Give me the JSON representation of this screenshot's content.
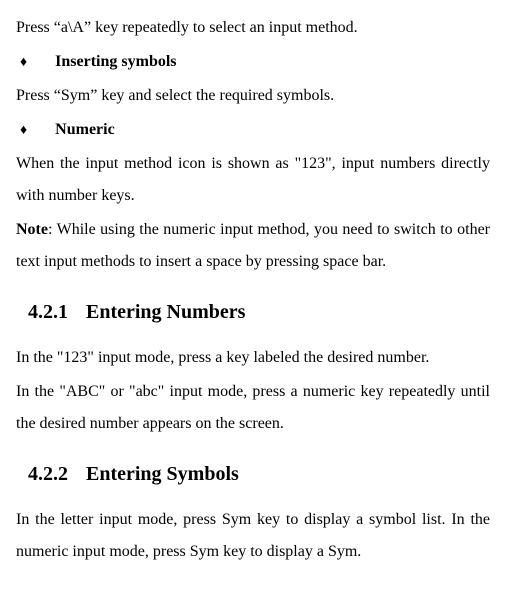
{
  "intro": {
    "line1": "Press “a\\A” key repeatedly to select an input method."
  },
  "bullets": {
    "diamond": "♦",
    "inserting_symbols": "Inserting symbols",
    "inserting_symbols_body": "Press “Sym” key and select the required symbols.",
    "numeric": "Numeric",
    "numeric_body": "When the input method icon is shown as \"123\", input numbers directly with number keys."
  },
  "note": {
    "label": "Note",
    "body": ": While using the numeric input method, you need to switch to other text input methods to insert a space by pressing space bar."
  },
  "section_421": {
    "num": "4.2.1",
    "title": "Entering Numbers",
    "p1": "In the \"123\" input mode, press a key labeled the desired number.",
    "p2": "In the \"ABC\" or \"abc\" input mode, press a numeric key repeatedly until the desired number appears on the screen."
  },
  "section_422": {
    "num": "4.2.2",
    "title": "Entering Symbols",
    "p1": "In the letter input mode, press Sym key to display a symbol list. In the numeric input mode, press Sym key to display a Sym."
  }
}
